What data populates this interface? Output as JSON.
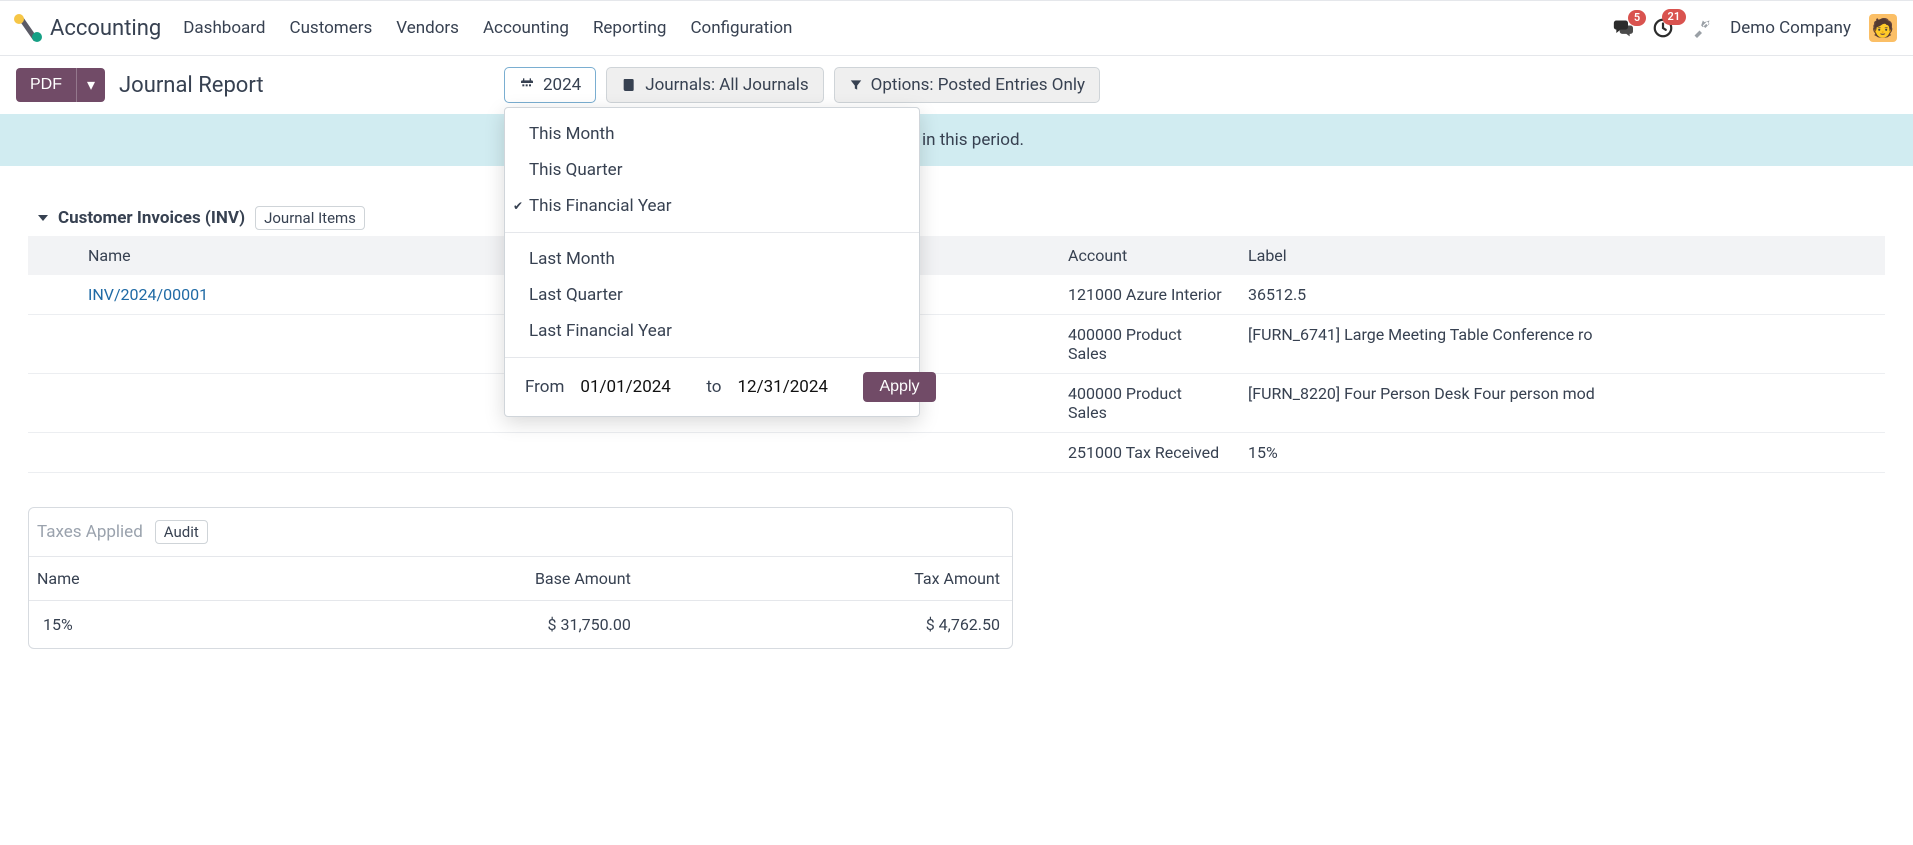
{
  "app_name": "Accounting",
  "menu": [
    "Dashboard",
    "Customers",
    "Vendors",
    "Accounting",
    "Reporting",
    "Configuration"
  ],
  "messages_badge": "5",
  "activities_badge": "21",
  "company": "Demo Company",
  "pdf_label": "PDF",
  "page_title": "Journal Report",
  "filters": {
    "period_label": "2024",
    "journals_label": "Journals: All Journals",
    "options_label": "Options: Posted Entries Only"
  },
  "period_dropdown": {
    "group1": [
      "This Month",
      "This Quarter",
      "This Financial Year"
    ],
    "selected1": "This Financial Year",
    "group2": [
      "Last Month",
      "Last Quarter",
      "Last Financial Year"
    ],
    "from_label": "From",
    "from_value": "01/01/2024",
    "to_label": "to",
    "to_value": "12/31/2024",
    "apply_label": "Apply"
  },
  "banner_text": "in this period.",
  "section": {
    "title": "Customer Invoices (INV)",
    "tag": "Journal Items"
  },
  "columns": {
    "name": "Name",
    "account": "Account",
    "label": "Label"
  },
  "rows": [
    {
      "name": "INV/2024/00001",
      "account": "121000 Azure Interior",
      "label": "36512.5"
    },
    {
      "name": "",
      "account": "400000 Product Sales",
      "label": "[FURN_6741] Large Meeting Table Conference ro"
    },
    {
      "name": "",
      "account": "400000 Product Sales",
      "label": "[FURN_8220] Four Person Desk Four person mod"
    },
    {
      "name": "",
      "account": "251000 Tax Received",
      "label": "15%"
    }
  ],
  "taxbox": {
    "title": "Taxes Applied",
    "audit": "Audit",
    "cols": {
      "name": "Name",
      "base": "Base Amount",
      "tax": "Tax Amount"
    },
    "rows": [
      {
        "name": "15%",
        "base": "$ 31,750.00",
        "tax": "$ 4,762.50"
      }
    ]
  }
}
